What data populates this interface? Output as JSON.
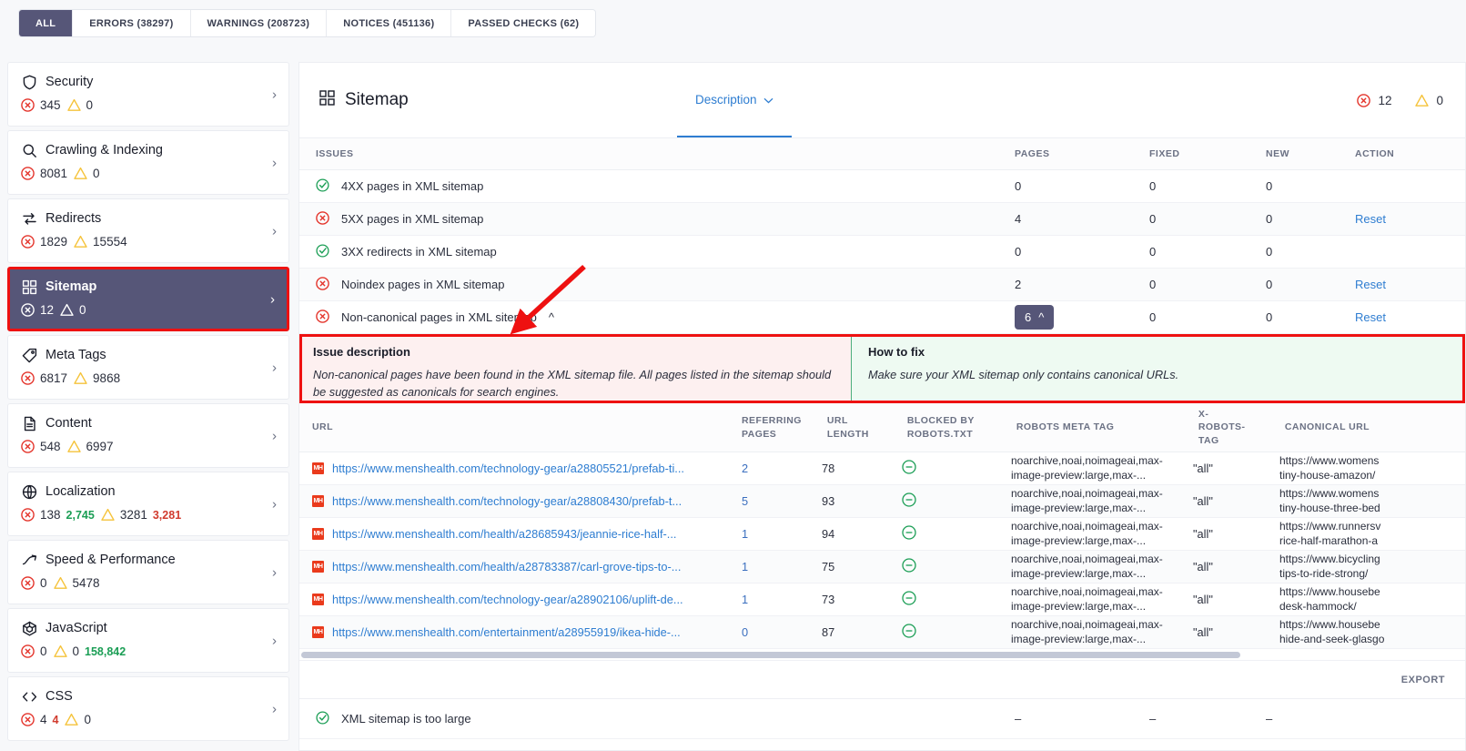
{
  "tabs": [
    {
      "label": "ALL",
      "active": true
    },
    {
      "label": "ERRORS (38297)",
      "active": false
    },
    {
      "label": "WARNINGS (208723)",
      "active": false
    },
    {
      "label": "NOTICES (451136)",
      "active": false
    },
    {
      "label": "PASSED CHECKS (62)",
      "active": false
    }
  ],
  "colors": {
    "accent_purple": "#565678",
    "link_blue": "#2e7dd1",
    "error_red": "#e4342b",
    "warning_yellow": "#f5c33b",
    "success_green": "#1b9e55",
    "annotation_red": "#ee1111"
  },
  "sidebar": {
    "items": [
      {
        "label": "Security",
        "icon": "shield-icon",
        "errors": "345",
        "warnings": "0",
        "selected": false
      },
      {
        "label": "Crawling & Indexing",
        "icon": "magnifier-icon",
        "errors": "8081",
        "warnings": "0",
        "selected": false
      },
      {
        "label": "Redirects",
        "icon": "redirect-arrows-icon",
        "errors": "1829",
        "warnings": "15554",
        "selected": false
      },
      {
        "label": "Sitemap",
        "icon": "grid-icon",
        "errors": "12",
        "warnings": "0",
        "selected": true
      },
      {
        "label": "Meta Tags",
        "icon": "tag-icon",
        "errors": "6817",
        "warnings": "9868",
        "selected": false
      },
      {
        "label": "Content",
        "icon": "document-icon",
        "errors": "548",
        "warnings": "6997",
        "selected": false
      },
      {
        "label": "Localization",
        "icon": "globe-icon",
        "errors": "138",
        "errors_delta": "2,745",
        "errors_delta_dir": "down",
        "warnings": "3281",
        "warnings_delta": "3,281",
        "warnings_delta_dir": "up",
        "selected": false
      },
      {
        "label": "Speed & Performance",
        "icon": "trend-up-icon",
        "errors": "0",
        "warnings": "5478",
        "selected": false
      },
      {
        "label": "JavaScript",
        "icon": "cube-icon",
        "errors": "0",
        "warnings": "0",
        "warnings_delta": "158,842",
        "warnings_delta_dir": "down",
        "selected": false
      },
      {
        "label": "CSS",
        "icon": "code-brackets-icon",
        "errors": "4",
        "errors_delta": "4",
        "errors_delta_dir": "up",
        "warnings": "0",
        "selected": false
      }
    ]
  },
  "panel": {
    "title": "Sitemap",
    "title_icon": "grid-icon",
    "description_tab": "Description",
    "errors_count": "12",
    "warnings_count": "0"
  },
  "issues_table": {
    "columns": [
      "ISSUES",
      "PAGES",
      "FIXED",
      "NEW",
      "ACTION"
    ],
    "rows": [
      {
        "status": "ok",
        "label": "4XX pages in XML sitemap",
        "pages": "0",
        "fixed": "0",
        "new": "0",
        "action": "",
        "expanded": false
      },
      {
        "status": "error",
        "label": "5XX pages in XML sitemap",
        "pages": "4",
        "fixed": "0",
        "new": "0",
        "action": "Reset",
        "expanded": false
      },
      {
        "status": "ok",
        "label": "3XX redirects in XML sitemap",
        "pages": "0",
        "fixed": "0",
        "new": "0",
        "action": "",
        "expanded": false
      },
      {
        "status": "error",
        "label": "Noindex pages in XML sitemap",
        "pages": "2",
        "fixed": "0",
        "new": "0",
        "action": "Reset",
        "expanded": false
      },
      {
        "status": "error",
        "label": "Non-canonical pages in XML sitemap",
        "pages": "6",
        "fixed": "0",
        "new": "0",
        "action": "Reset",
        "expanded": true
      }
    ],
    "bottom_row": {
      "status": "ok",
      "label": "XML sitemap is too large",
      "pages": "–",
      "fixed": "–",
      "new": "–",
      "action": ""
    }
  },
  "callout": {
    "description_heading": "Issue description",
    "description_body": "Non-canonical pages have been found in the XML sitemap file. All pages listed in the sitemap should be suggested as canonicals for search engines.",
    "fix_heading": "How to fix",
    "fix_body": "Make sure your XML sitemap only contains canonical URLs."
  },
  "url_table": {
    "columns": [
      "URL",
      "REFERRING\nPAGES",
      "URL\nLENGTH",
      "BLOCKED BY\nROBOTS.TXT",
      "ROBOTS META TAG",
      "X-\nROBOTS-\nTAG",
      "CANONICAL URL"
    ],
    "rows": [
      {
        "url": "https://www.menshealth.com/technology-gear/a28805521/prefab-ti...",
        "referring_pages": "2",
        "url_length": "78",
        "blocked": "none",
        "robots_meta": "noarchive,noai,noimageai,max-image-preview:large,max-...",
        "x_robots_tag": "\"all\"",
        "canonical_url": "https://www.womens\ntiny-house-amazon/"
      },
      {
        "url": "https://www.menshealth.com/technology-gear/a28808430/prefab-t...",
        "referring_pages": "5",
        "url_length": "93",
        "blocked": "none",
        "robots_meta": "noarchive,noai,noimageai,max-image-preview:large,max-...",
        "x_robots_tag": "\"all\"",
        "canonical_url": "https://www.womens\ntiny-house-three-bed"
      },
      {
        "url": "https://www.menshealth.com/health/a28685943/jeannie-rice-half-...",
        "referring_pages": "1",
        "url_length": "94",
        "blocked": "none",
        "robots_meta": "noarchive,noai,noimageai,max-image-preview:large,max-...",
        "x_robots_tag": "\"all\"",
        "canonical_url": "https://www.runnersv\nrice-half-marathon-a"
      },
      {
        "url": "https://www.menshealth.com/health/a28783387/carl-grove-tips-to-...",
        "referring_pages": "1",
        "url_length": "75",
        "blocked": "none",
        "robots_meta": "noarchive,noai,noimageai,max-image-preview:large,max-...",
        "x_robots_tag": "\"all\"",
        "canonical_url": "https://www.bicycling\ntips-to-ride-strong/"
      },
      {
        "url": "https://www.menshealth.com/technology-gear/a28902106/uplift-de...",
        "referring_pages": "1",
        "url_length": "73",
        "blocked": "none",
        "robots_meta": "noarchive,noai,noimageai,max-image-preview:large,max-...",
        "x_robots_tag": "\"all\"",
        "canonical_url": "https://www.housebe\ndesk-hammock/"
      },
      {
        "url": "https://www.menshealth.com/entertainment/a28955919/ikea-hide-...",
        "referring_pages": "0",
        "url_length": "87",
        "blocked": "none",
        "robots_meta": "noarchive,noai,noimageai,max-image-preview:large,max-...",
        "x_robots_tag": "\"all\"",
        "canonical_url": "https://www.housebe\nhide-and-seek-glasgo"
      }
    ],
    "export_label": "EXPORT"
  },
  "favicon_text": "MH"
}
